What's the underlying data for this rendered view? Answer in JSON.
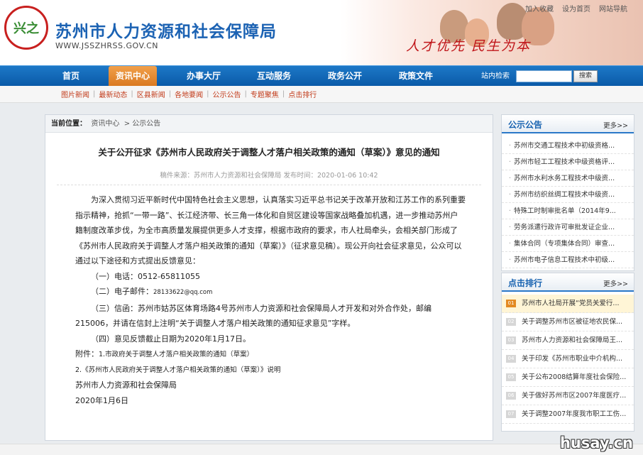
{
  "header": {
    "title": "苏州市人力资源和社会保障局",
    "url": "WWW.JSSZHRSS.GOV.CN",
    "slogan": "人才优先 民生为本",
    "logo_text": "兴之",
    "top_links": [
      "加入收藏",
      "设为首页",
      "网站导航"
    ]
  },
  "nav": {
    "items": [
      "首页",
      "资讯中心",
      "办事大厅",
      "互动服务",
      "政务公开",
      "政策文件"
    ],
    "active": "资讯中心",
    "search_label": "站内检索",
    "search_value": "",
    "search_button": "搜索"
  },
  "subnav": [
    "图片新闻",
    "最新动态",
    "区县新闻",
    "各地要闻",
    "公示公告",
    "专题聚焦",
    "点击排行"
  ],
  "breadcrumb": {
    "label": "当前位置：",
    "items": [
      "资讯中心",
      "公示公告"
    ]
  },
  "article": {
    "title": "关于公开征求《苏州市人民政府关于调整人才落户相关政策的通知（草案）》意见的通知",
    "meta": "稿件来源：苏州市人力资源和社会保障局 发布时间：2020-01-06 10:42",
    "intro": "为深入贯彻习近平新时代中国特色社会主义思想，认真落实习近平总书记关于改革开放和江苏工作的系列重要指示精神，抢抓“一带一路”、长江经济带、长三角一体化和自贸区建设等国家战略叠加机遇，进一步推动苏州户籍制度改革步伐，为全市高质量发展提供更多人才支撑，根据市政府的要求，市人社局牵头，会相关部门形成了《苏州市人民政府关于调整人才落户相关政策的通知（草案）》（征求意见稿）。现公开向社会征求意见，公众可以通过以下途径和方式提出反馈意见：",
    "item1": "（一）电话：0512-65811055",
    "item2_prefix": "（二）电子邮件：",
    "item2_email": "28133622@qq.com",
    "item3": "（三）信函：苏州市姑苏区体育场路4号苏州市人力资源和社会保障局人才开发和对外合作处，邮编215006，并请在信封上注明“关于调整人才落户相关政策的通知征求意见”字样。",
    "item4": "（四）意见反馈截止日期为2020年1月17日。",
    "attachment_label": "附件：",
    "attachment1": "1.市政府关于调整人才落户相关政策的通知（草案）",
    "attachment2": "2.《苏州市人民政府关于调整人才落户相关政策的通知（草案）》说明",
    "signature": "苏州市人力资源和社会保障局",
    "date": "2020年1月6日"
  },
  "sidebar": {
    "notices_title": "公示公告",
    "hot_title": "点击排行",
    "more": "更多>>",
    "notices": [
      "苏州市交通工程技术中初级资格...",
      "苏州市轻工工程技术中级资格评...",
      "苏州市水利水务工程技术中级资...",
      "苏州市纺织丝绸工程技术中级资...",
      "特殊工时制审批名单（2014年9...",
      "劳务派遣行政许可审批发证企业...",
      "集体合同（专项集体合同）审查...",
      "苏州市电子信息工程技术中初级..."
    ],
    "hot": [
      {
        "num": "01",
        "text": "苏州市人社局开展“党员关爱行..."
      },
      {
        "num": "02",
        "text": "关于调整苏州市区被征地农民保..."
      },
      {
        "num": "03",
        "text": "苏州市人力资源和社会保障局王..."
      },
      {
        "num": "04",
        "text": "关于印发《苏州市职业中介机构..."
      },
      {
        "num": "05",
        "text": "关于公布2008结算年度社会保险..."
      },
      {
        "num": "06",
        "text": "关于做好苏州市区2007年度医疗..."
      },
      {
        "num": "07",
        "text": "关于调整2007年度我市职工工伤..."
      }
    ]
  },
  "watermark": "husay.cn",
  "colors": {
    "brand": "#1b62b3",
    "nav": "#0a5aa8",
    "accent": "#e38a22",
    "subnav_text": "#c23b1a"
  }
}
